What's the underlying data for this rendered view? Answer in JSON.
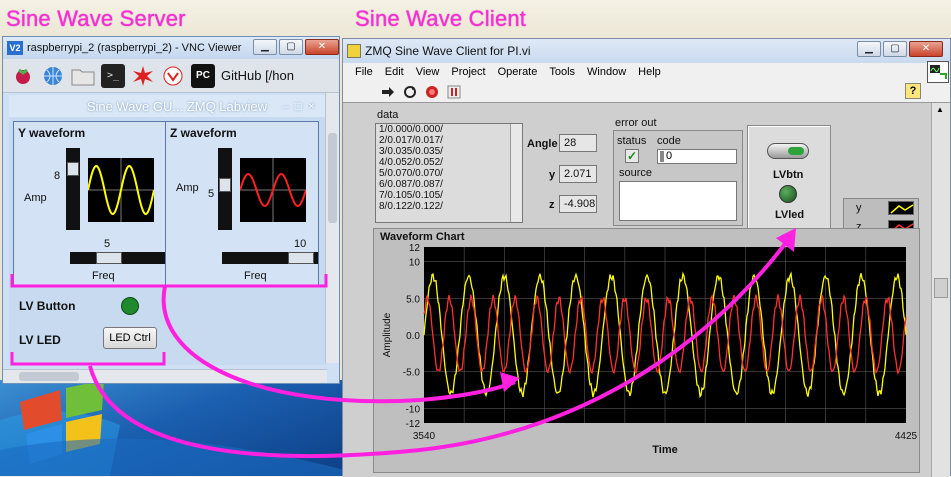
{
  "labels": {
    "server_title": "Sine Wave Server",
    "client_title": "Sine Wave Client"
  },
  "vnc": {
    "title": "raspberrypi_2 (raspberrypi_2) - VNC Viewer",
    "github_tab": "GitHub [/hon",
    "app_title": "Sine Wave GU... ZMQ Labview",
    "y_waveform": {
      "title": "Y waveform",
      "amp_label": "Amp",
      "amp_value": "8",
      "freq_value": "5",
      "freq_label": "Freq"
    },
    "z_waveform": {
      "title": "Z waveform",
      "amp_label": "Amp",
      "amp_value": "5",
      "freq_value": "10",
      "freq_label": "Freq"
    },
    "lv_button_label": "LV Button",
    "lv_led_label": "LV LED",
    "led_ctrl_button": "LED Ctrl",
    "led_color": "#1e8a2c"
  },
  "lv": {
    "title": "ZMQ Sine Wave Client for PI.vi",
    "menu": [
      "File",
      "Edit",
      "View",
      "Project",
      "Operate",
      "Tools",
      "Window",
      "Help"
    ],
    "data_label": "data",
    "data_rows": [
      "1/0.000/0.000/",
      "2/0.017/0.017/",
      "3/0.035/0.035/",
      "4/0.052/0.052/",
      "5/0.070/0.070/",
      "6/0.087/0.087/",
      "7/0.105/0.105/",
      "8/0.122/0.122/"
    ],
    "angle_label": "Angle",
    "angle_value": "28",
    "y_label": "y",
    "y_value": "2.071",
    "z_label": "z",
    "z_value": "-4.908",
    "error_out_label": "error out",
    "status_label": "status",
    "code_label": "code",
    "code_value": "0",
    "source_label": "source",
    "lvbtn_label": "LVbtn",
    "lvled_label": "LVled",
    "legend": [
      {
        "name": "y",
        "color": "#ffff00"
      },
      {
        "name": "z",
        "color": "#ff3030"
      }
    ],
    "help_icon": "?"
  },
  "chart_data": {
    "type": "line",
    "title": "Waveform Chart",
    "xlabel": "Time",
    "ylabel": "Amplitude",
    "xlim": [
      3540,
      4425
    ],
    "ylim": [
      -12,
      12
    ],
    "x_ticks": [
      "3540",
      "4425"
    ],
    "y_ticks": [
      "12",
      "10",
      "5.0",
      "0.0",
      "-5.0",
      "-10",
      "-12"
    ],
    "grid": true,
    "background": "#000000",
    "series": [
      {
        "name": "y",
        "color": "#ffff00",
        "amplitude": 8,
        "cycles": 13.5
      },
      {
        "name": "z",
        "color": "#ff3030",
        "amplitude": 5,
        "cycles": 22
      }
    ]
  }
}
